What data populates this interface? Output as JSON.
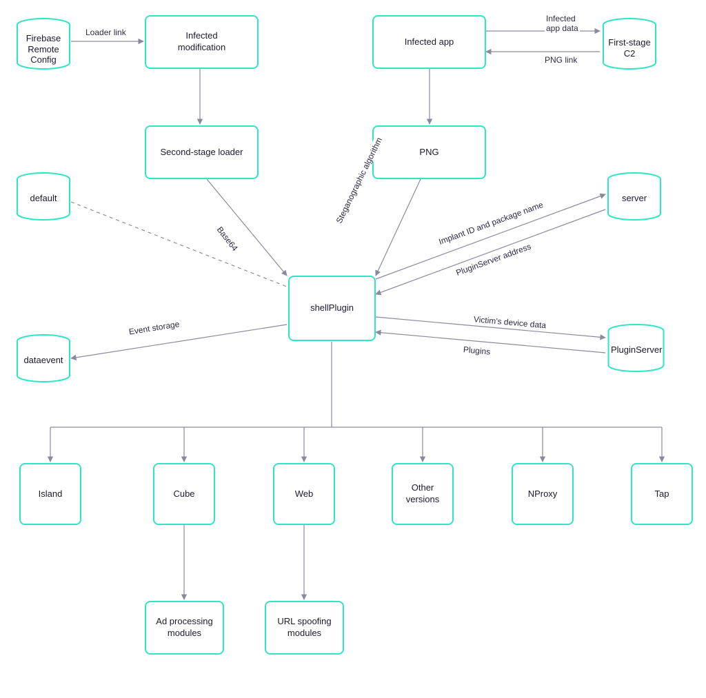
{
  "colors": {
    "accent": "#2ee6c5",
    "arrow": "#8a8a9e",
    "text": "#1a1a2e"
  },
  "nodes": {
    "firebase": {
      "label": "Firebase\nRemote\nConfig"
    },
    "infectedMod": {
      "label": "Infected\nmodification"
    },
    "secondStage": {
      "label": "Second-stage loader"
    },
    "default": {
      "label": "default"
    },
    "dataevent": {
      "label": "dataevent"
    },
    "infectedApp": {
      "label": "Infected app"
    },
    "firstStageC2": {
      "label": "First-stage\nC2"
    },
    "png": {
      "label": "PNG"
    },
    "server": {
      "label": "server"
    },
    "pluginServer": {
      "label": "PluginServer"
    },
    "shellPlugin": {
      "label": "shellPlugin"
    },
    "island": {
      "label": "Island"
    },
    "cube": {
      "label": "Cube"
    },
    "web": {
      "label": "Web"
    },
    "otherVer": {
      "label": "Other\nversions"
    },
    "nproxy": {
      "label": "NProxy"
    },
    "tap": {
      "label": "Tap"
    },
    "adProc": {
      "label": "Ad processing\nmodules"
    },
    "urlSpoof": {
      "label": "URL spoofing\nmodules"
    }
  },
  "edges": {
    "loaderLink": {
      "label": "Loader link"
    },
    "infectedAppData": {
      "label": "Infected\napp data"
    },
    "pngLink": {
      "label": "PNG link"
    },
    "base64": {
      "label": "Base64"
    },
    "stego": {
      "label": "Steganographic algorithm"
    },
    "implantId": {
      "label": "Implant ID and package name"
    },
    "pluginSrvAddr": {
      "label": "PluginServer address"
    },
    "victimDevice": {
      "label": "Victim's device data"
    },
    "plugins": {
      "label": "Plugins"
    },
    "eventStorage": {
      "label": "Event storage"
    }
  }
}
